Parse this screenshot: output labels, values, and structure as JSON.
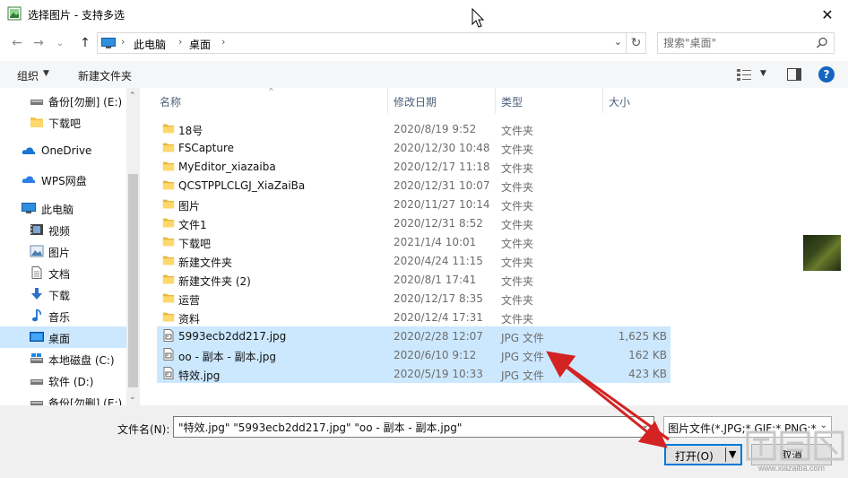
{
  "window": {
    "title": "选择图片 - 支持多选",
    "close_glyph": "✕"
  },
  "address": {
    "crumbs": [
      "此电脑",
      "桌面"
    ],
    "crumb_sep": "›",
    "search_placeholder": "搜索\"桌面\""
  },
  "toolbar": {
    "organize": "组织",
    "new_folder": "新建文件夹"
  },
  "sidebar": {
    "items": [
      {
        "label": "备份[勿删] (E:)",
        "icon": "drive-icon"
      },
      {
        "label": "下载吧",
        "icon": "folder-icon"
      },
      {
        "label": "OneDrive",
        "icon": "cloud-icon"
      },
      {
        "label": "WPS网盘",
        "icon": "cloud-icon"
      },
      {
        "label": "此电脑",
        "icon": "computer-icon"
      },
      {
        "label": "视频",
        "icon": "video-icon"
      },
      {
        "label": "图片",
        "icon": "pictures-icon"
      },
      {
        "label": "文档",
        "icon": "document-icon"
      },
      {
        "label": "下载",
        "icon": "download-icon"
      },
      {
        "label": "音乐",
        "icon": "music-icon"
      },
      {
        "label": "桌面",
        "icon": "desktop-icon"
      },
      {
        "label": "本地磁盘 (C:)",
        "icon": "drive-icon"
      },
      {
        "label": "软件 (D:)",
        "icon": "drive-icon"
      },
      {
        "label": "备份[勿删] (E:)",
        "icon": "drive-icon"
      }
    ],
    "selected_index": 10
  },
  "columns": {
    "name": "名称",
    "date": "修改日期",
    "type": "类型",
    "size": "大小"
  },
  "files": [
    {
      "name": "18号",
      "date": "2020/8/19 9:52",
      "type": "文件夹",
      "size": "",
      "kind": "folder",
      "selected": false
    },
    {
      "name": "FSCapture",
      "date": "2020/12/30 10:48",
      "type": "文件夹",
      "size": "",
      "kind": "folder",
      "selected": false
    },
    {
      "name": "MyEditor_xiazaiba",
      "date": "2020/12/17 11:18",
      "type": "文件夹",
      "size": "",
      "kind": "folder",
      "selected": false
    },
    {
      "name": "QCSTPPLCLGJ_XiaZaiBa",
      "date": "2020/12/31 10:07",
      "type": "文件夹",
      "size": "",
      "kind": "folder",
      "selected": false
    },
    {
      "name": "图片",
      "date": "2020/11/27 10:14",
      "type": "文件夹",
      "size": "",
      "kind": "folder",
      "selected": false
    },
    {
      "name": "文件1",
      "date": "2020/12/31 8:52",
      "type": "文件夹",
      "size": "",
      "kind": "folder",
      "selected": false
    },
    {
      "name": "下载吧",
      "date": "2021/1/4 10:01",
      "type": "文件夹",
      "size": "",
      "kind": "folder",
      "selected": false
    },
    {
      "name": "新建文件夹",
      "date": "2020/4/24 11:15",
      "type": "文件夹",
      "size": "",
      "kind": "folder",
      "selected": false
    },
    {
      "name": "新建文件夹 (2)",
      "date": "2020/8/1 17:41",
      "type": "文件夹",
      "size": "",
      "kind": "folder",
      "selected": false
    },
    {
      "name": "运营",
      "date": "2020/12/17 8:35",
      "type": "文件夹",
      "size": "",
      "kind": "folder",
      "selected": false
    },
    {
      "name": "资料",
      "date": "2020/12/4 17:31",
      "type": "文件夹",
      "size": "",
      "kind": "folder",
      "selected": false
    },
    {
      "name": "5993ecb2dd217.jpg",
      "date": "2020/2/28 12:07",
      "type": "JPG 文件",
      "size": "1,625 KB",
      "kind": "image",
      "selected": true
    },
    {
      "name": "oo - 副本 - 副本.jpg",
      "date": "2020/6/10 9:12",
      "type": "JPG 文件",
      "size": "162 KB",
      "kind": "image",
      "selected": true
    },
    {
      "name": "特效.jpg",
      "date": "2020/5/19 10:33",
      "type": "JPG 文件",
      "size": "423 KB",
      "kind": "image",
      "selected": true
    }
  ],
  "bottom": {
    "filename_label": "文件名(N):",
    "filename_value": "\"特效.jpg\" \"5993ecb2dd217.jpg\" \"oo - 副本 - 副本.jpg\"",
    "filter": "图片文件(*.JPG;*.GIF;*.PNG;*.BMP)",
    "open": "打开(O)",
    "cancel": "取消"
  },
  "watermark": {
    "site": "www.xiazaiba.com"
  },
  "colors": {
    "selection": "#cce8ff",
    "accent": "#0078d7",
    "arrow": "#d32323",
    "folder": "#f5c54a"
  }
}
